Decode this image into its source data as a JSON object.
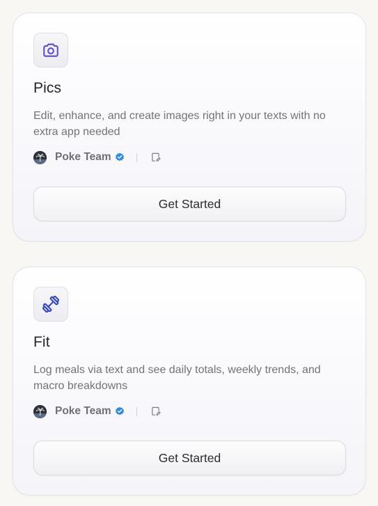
{
  "cards": [
    {
      "icon": "camera-icon",
      "title": "Pics",
      "description": "Edit, enhance, and create images right in your texts with no extra app needed",
      "author": "Poke Team",
      "button_label": "Get Started"
    },
    {
      "icon": "dumbbell-icon",
      "title": "Fit",
      "description": "Log meals via text and see daily totals, weekly trends, and macro breakdowns",
      "author": "Poke Team",
      "button_label": "Get Started"
    }
  ],
  "colors": {
    "camera_icon": "#5b4bd6",
    "dumbbell_icon": "#3347c9",
    "verified_badge": "#2f8be6",
    "background": "#f8f7f4"
  }
}
